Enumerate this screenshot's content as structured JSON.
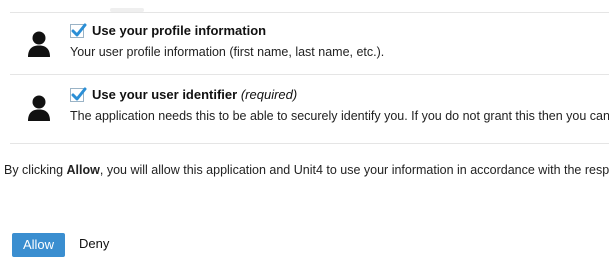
{
  "permissions": [
    {
      "title": "Use your profile information",
      "required_label": "",
      "description": "Your user profile information (first name, last name, etc.).",
      "checked": true,
      "icon": "user-icon"
    },
    {
      "title": "Use your user identifier",
      "required_label": "(required)",
      "description": "The application needs this to be able to securely identify you. If you do not grant this then you cann",
      "checked": true,
      "icon": "user-icon"
    }
  ],
  "consent": {
    "prefix": "By clicking ",
    "emphasis": "Allow",
    "suffix": ", you will allow this application and Unit4 to use your information in accordance with the resp"
  },
  "actions": {
    "allow_label": "Allow",
    "deny_label": "Deny"
  },
  "colors": {
    "accent": "#3a8ed0",
    "checkmark": "#2b8fd6",
    "divider": "#e5e5e5"
  }
}
